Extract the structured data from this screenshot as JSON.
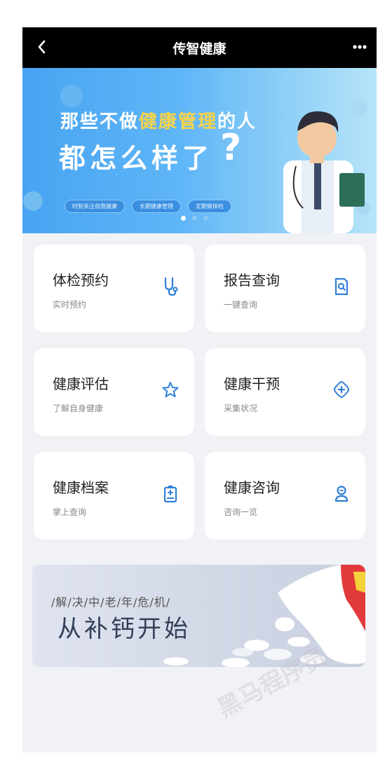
{
  "nav": {
    "title": "传智健康"
  },
  "banner": {
    "line1_a": "那些不做",
    "line1_highlight": "健康管理",
    "line1_b": "的人",
    "line2": "都怎么样了",
    "question_mark": "?",
    "tags": [
      "时刻关注自我健康",
      "长期健康管理",
      "定期做体检"
    ],
    "dots_total": 3,
    "active_dot": 0
  },
  "cards": [
    {
      "title": "体检预约",
      "subtitle": "实时预约",
      "icon": "stethoscope-icon"
    },
    {
      "title": "报告查询",
      "subtitle": "一键查询",
      "icon": "report-search-icon"
    },
    {
      "title": "健康评估",
      "subtitle": "了解自身健康",
      "icon": "star-icon"
    },
    {
      "title": "健康干预",
      "subtitle": "采集状况",
      "icon": "plus-diamond-icon"
    },
    {
      "title": "健康档案",
      "subtitle": "掌上查询",
      "icon": "battery-file-icon"
    },
    {
      "title": "健康咨询",
      "subtitle": "咨询一览",
      "icon": "consultant-icon"
    }
  ],
  "promo": {
    "subtitle": "/解/决/中/老/年/危/机/",
    "title": "从补钙开始"
  },
  "watermark": "黑马程序员",
  "colors": {
    "accent": "#2f7fd8",
    "nav_bg": "#000000",
    "page_bg": "#f1f2f6"
  }
}
